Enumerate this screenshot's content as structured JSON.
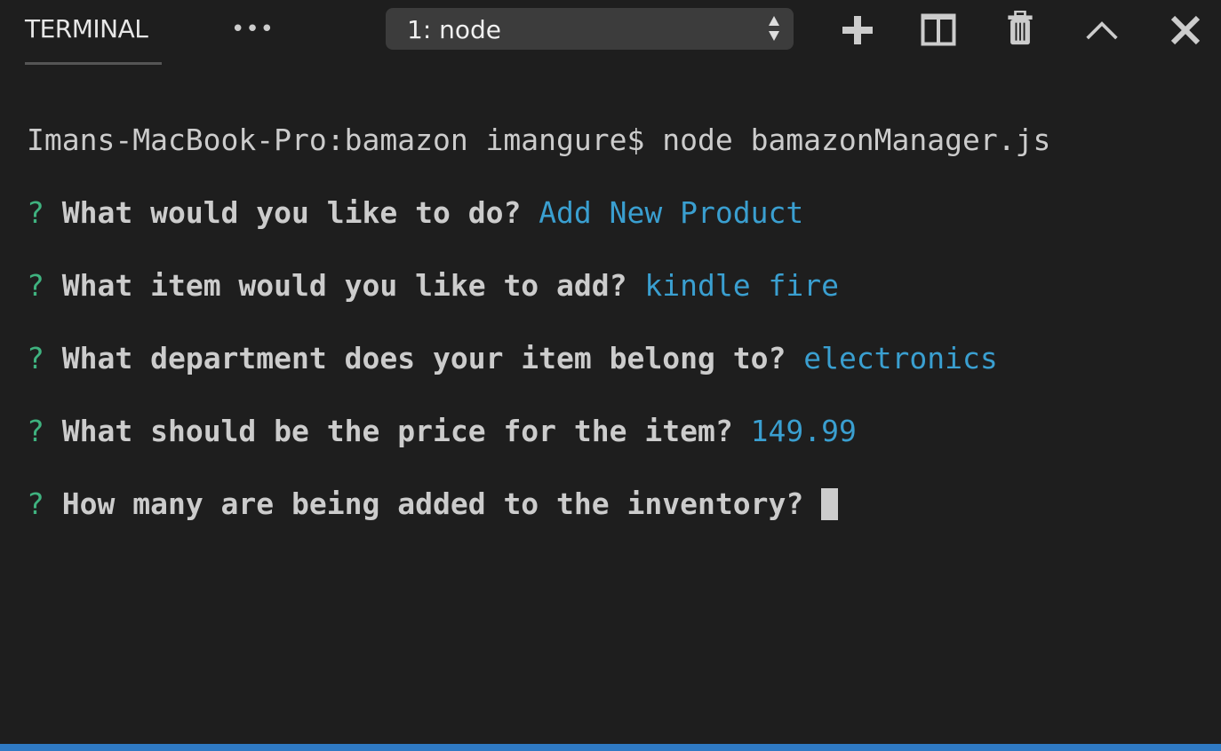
{
  "panel": {
    "tab_label": "TERMINAL",
    "more_icon": "ellipsis-icon",
    "terminal_select": {
      "selected": "1: node"
    },
    "actions": [
      "plus-icon",
      "split-icon",
      "trash-icon",
      "chevron-up-icon",
      "close-icon"
    ]
  },
  "terminal": {
    "command_line": "Imans-MacBook-Pro:bamazon imangure$ node bamazonManager.js",
    "prompts": [
      {
        "mark": "?",
        "question": "What would you like to do?",
        "answer": "Add New Product"
      },
      {
        "mark": "?",
        "question": "What item would you like to add?",
        "answer": "kindle fire"
      },
      {
        "mark": "?",
        "question": "What department does your item belong to?",
        "answer": "electronics"
      },
      {
        "mark": "?",
        "question": "What should be the price for the item?",
        "answer": "149.99"
      },
      {
        "mark": "?",
        "question": "How many are being added to the inventory?",
        "answer": ""
      }
    ]
  },
  "colors": {
    "background": "#1e1e1e",
    "prompt_mark": "#3fb27f",
    "answer": "#3a9fd0",
    "status_bar": "#2f7ac4"
  }
}
